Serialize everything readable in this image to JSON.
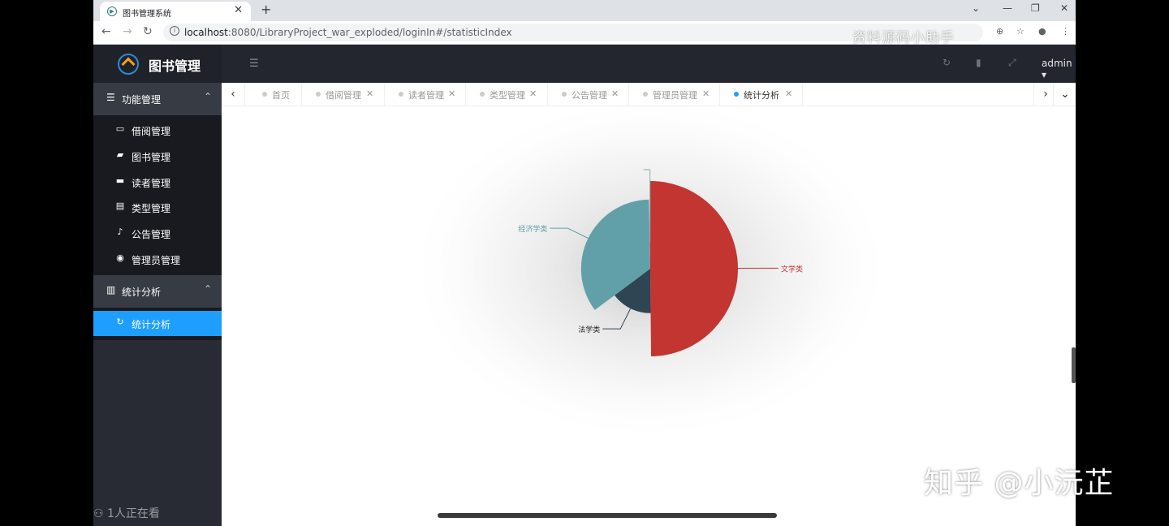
{
  "browser": {
    "tab_title": "图书管理系统",
    "url_host": "localhost",
    "url_rest": ":8080/LibraryProject_war_exploded/loginIn#/statisticIndex",
    "watermark": "资料源码小助手"
  },
  "header": {
    "logo_text": "图书管理",
    "user": "admin"
  },
  "sidebar": {
    "group1": "功能管理",
    "items": [
      {
        "label": "借阅管理",
        "icon": "window-icon"
      },
      {
        "label": "图书管理",
        "icon": "book-icon"
      },
      {
        "label": "读者管理",
        "icon": "card-icon"
      },
      {
        "label": "类型管理",
        "icon": "document-icon"
      },
      {
        "label": "公告管理",
        "icon": "bell-icon"
      },
      {
        "label": "管理员管理",
        "icon": "user-circle-icon"
      }
    ],
    "group2": "统计分析",
    "active_item": "统计分析",
    "viewers": "1人正在看"
  },
  "tabs": [
    {
      "label": "首页",
      "active": false,
      "closable": false
    },
    {
      "label": "借阅管理",
      "active": false,
      "closable": true
    },
    {
      "label": "读者管理",
      "active": false,
      "closable": true
    },
    {
      "label": "类型管理",
      "active": false,
      "closable": true
    },
    {
      "label": "公告管理",
      "active": false,
      "closable": true
    },
    {
      "label": "管理员管理",
      "active": false,
      "closable": true
    },
    {
      "label": "统计分析",
      "active": true,
      "closable": true
    }
  ],
  "chart_data": {
    "type": "pie",
    "variant": "rose",
    "slices": [
      {
        "name": "文学类",
        "value": 50,
        "color": "#c23531"
      },
      {
        "name": "法学类",
        "value": 15,
        "color": "#2f4554"
      },
      {
        "name": "经济学类",
        "value": 35,
        "color": "#61a0a8"
      },
      {
        "name": "",
        "value": 0.3,
        "color": "#d48265"
      }
    ]
  },
  "watermark_bottom": "知乎 @小沅芷"
}
